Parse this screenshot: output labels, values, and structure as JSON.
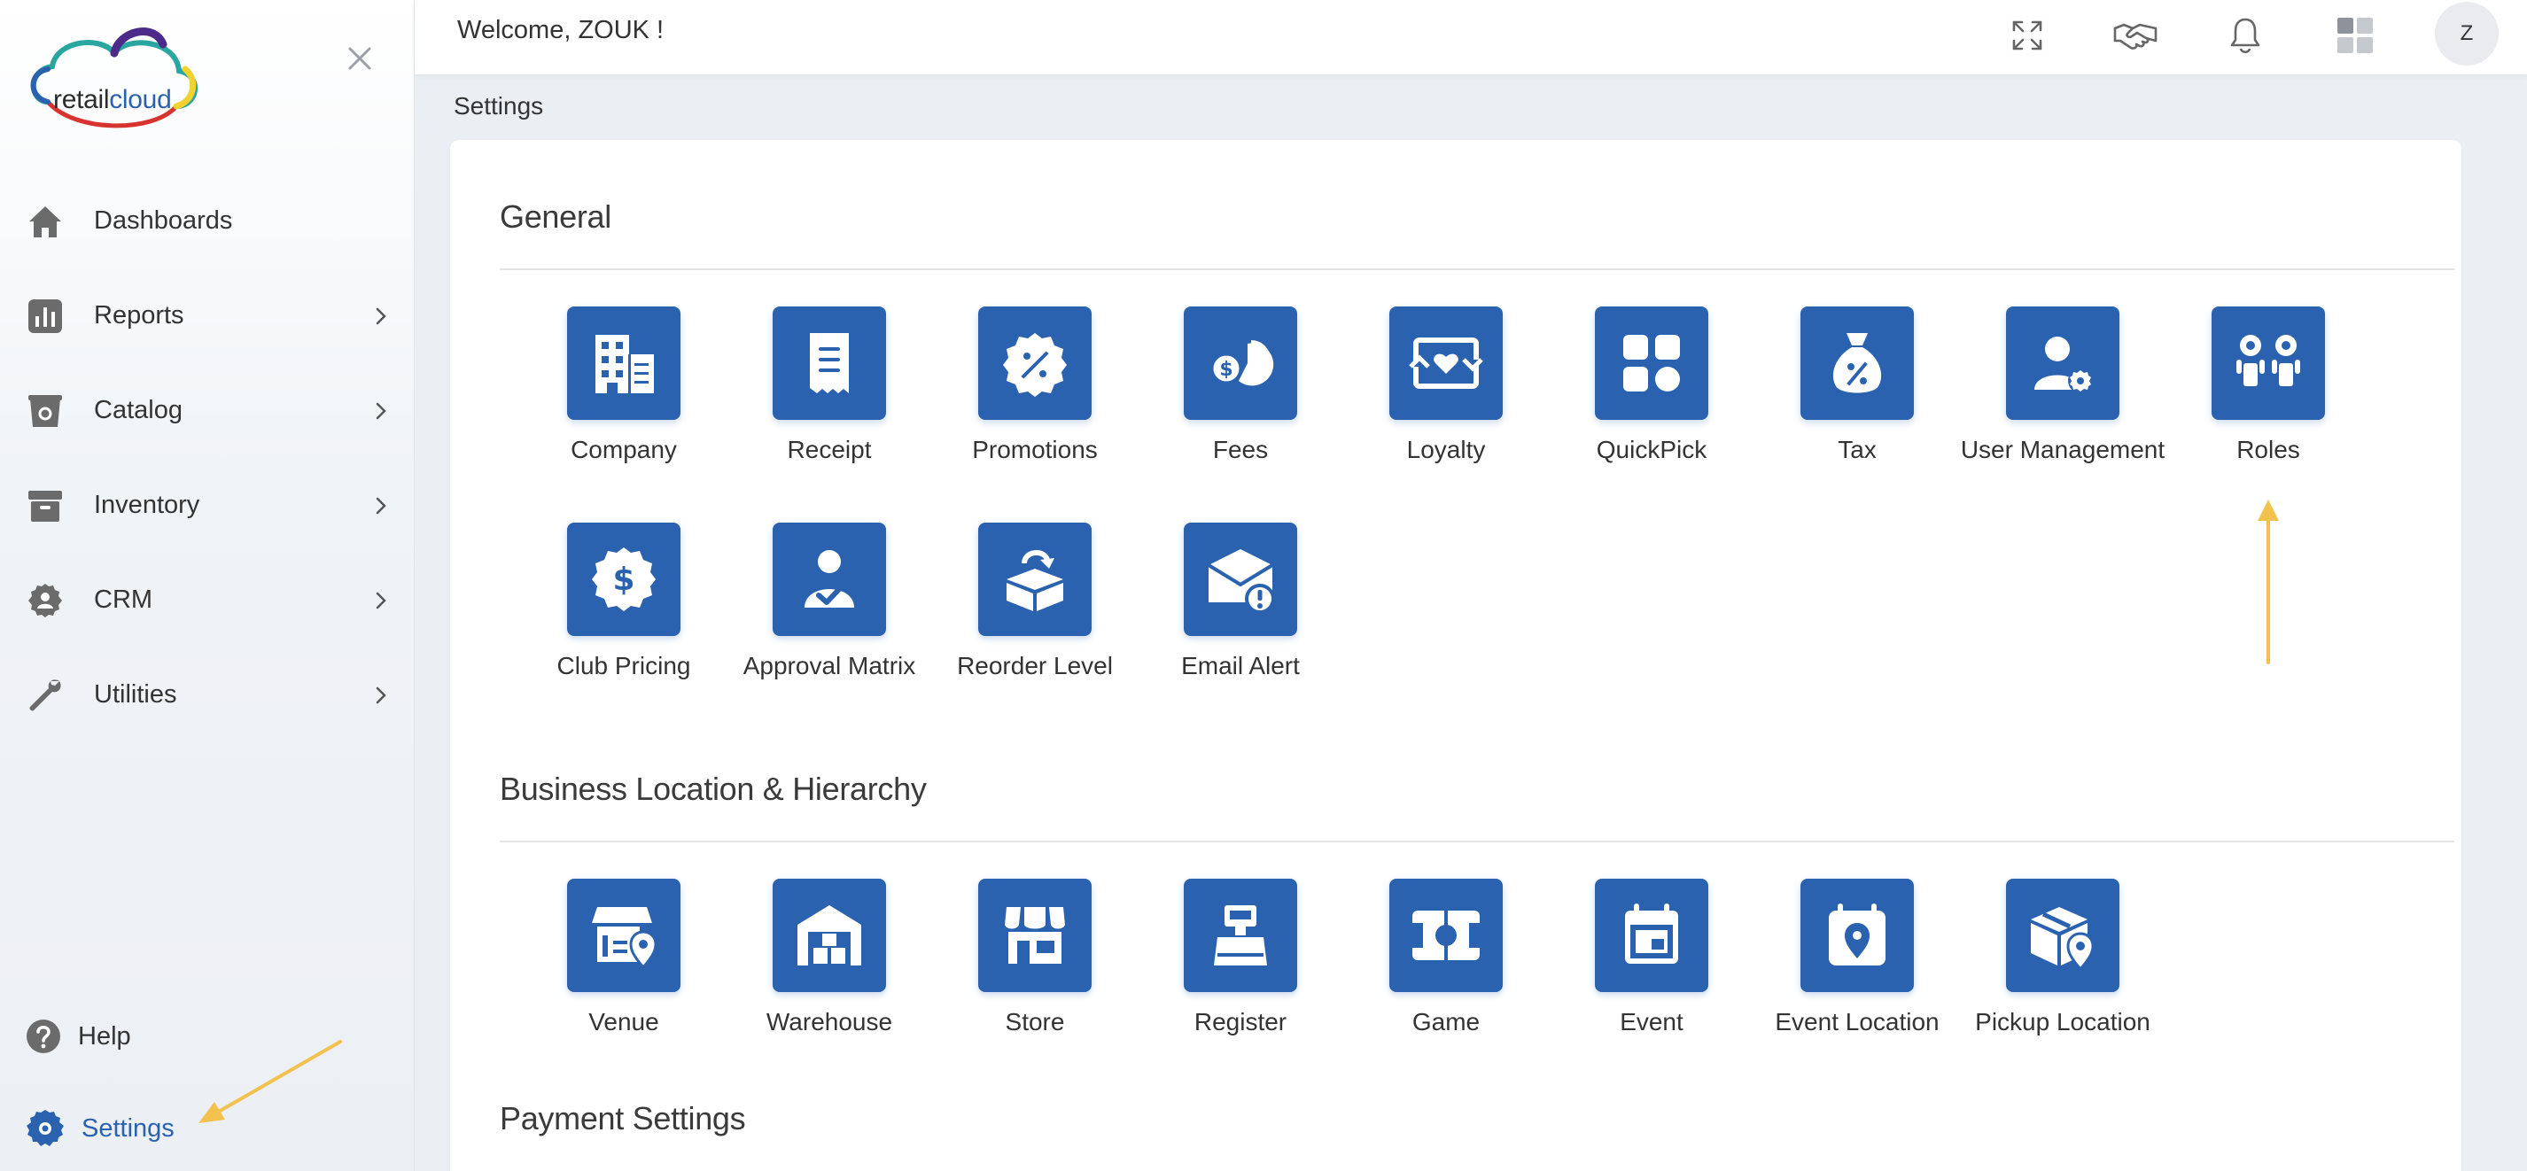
{
  "app": {
    "logo": {
      "text_main": "retail",
      "text_accent": "cloud"
    },
    "welcome": "Welcome, ZOUK !",
    "avatar_initial": "Z",
    "breadcrumb": "Settings"
  },
  "sidebar": {
    "items": [
      {
        "label": "Dashboards",
        "icon": "home-icon",
        "chevron": false
      },
      {
        "label": "Reports",
        "icon": "bar-chart-icon",
        "chevron": true
      },
      {
        "label": "Catalog",
        "icon": "catalog-icon",
        "chevron": true
      },
      {
        "label": "Inventory",
        "icon": "archive-box-icon",
        "chevron": true
      },
      {
        "label": "CRM",
        "icon": "crm-user-icon",
        "chevron": true
      },
      {
        "label": "Utilities",
        "icon": "wrench-icon",
        "chevron": true
      }
    ],
    "help_label": "Help",
    "settings_label": "Settings"
  },
  "sections": {
    "general": {
      "title": "General",
      "tiles": [
        {
          "label": "Company",
          "icon": "building-icon"
        },
        {
          "label": "Receipt",
          "icon": "receipt-icon"
        },
        {
          "label": "Promotions",
          "icon": "discount-badge-icon"
        },
        {
          "label": "Fees",
          "icon": "fees-icon"
        },
        {
          "label": "Loyalty",
          "icon": "loyalty-icon"
        },
        {
          "label": "QuickPick",
          "icon": "grid-icon"
        },
        {
          "label": "Tax",
          "icon": "tax-bag-icon"
        },
        {
          "label": "User Management",
          "icon": "user-gear-icon"
        },
        {
          "label": "Roles",
          "icon": "roles-icon"
        },
        {
          "label": "Club Pricing",
          "icon": "dollar-badge-icon"
        },
        {
          "label": "Approval Matrix",
          "icon": "user-check-icon"
        },
        {
          "label": "Reorder Level",
          "icon": "reorder-box-icon"
        },
        {
          "label": "Email Alert",
          "icon": "email-alert-icon"
        }
      ]
    },
    "business": {
      "title": "Business Location & Hierarchy",
      "tiles": [
        {
          "label": "Venue",
          "icon": "venue-icon"
        },
        {
          "label": "Warehouse",
          "icon": "warehouse-icon"
        },
        {
          "label": "Store",
          "icon": "store-icon"
        },
        {
          "label": "Register",
          "icon": "register-icon"
        },
        {
          "label": "Game",
          "icon": "game-icon"
        },
        {
          "label": "Event",
          "icon": "calendar-icon"
        },
        {
          "label": "Event Location",
          "icon": "calendar-pin-icon"
        },
        {
          "label": "Pickup Location",
          "icon": "package-pin-icon"
        }
      ]
    },
    "payment": {
      "title": "Payment Settings"
    }
  },
  "colors": {
    "tile_blue": "#2a62b0",
    "accent_arrow": "#f2c14e",
    "notif_red": "#e5322d"
  }
}
